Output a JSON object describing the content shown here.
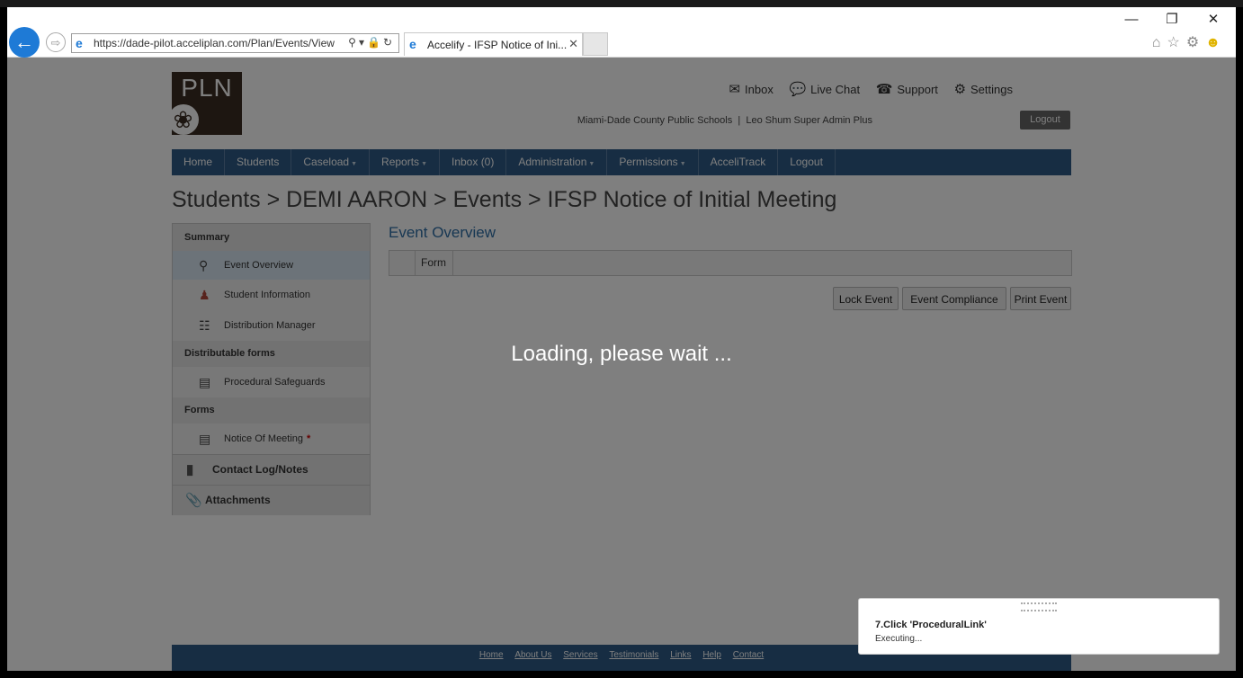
{
  "browser": {
    "url": "https://dade-pilot.acceliplan.com/Plan/Events/View",
    "tab_title": "Accelify - IFSP Notice of Ini...",
    "window_controls": {
      "minimize": "—",
      "restore": "❐",
      "close": "✕"
    }
  },
  "header": {
    "logo_text": "PLN",
    "links": [
      {
        "icon": "mail-icon",
        "label": "Inbox"
      },
      {
        "icon": "chat-icon",
        "label": "Live Chat"
      },
      {
        "icon": "phone-icon",
        "label": "Support"
      },
      {
        "icon": "gear-icon",
        "label": "Settings"
      }
    ],
    "organization": "Miami-Dade County Public Schools",
    "separator": "|",
    "user": "Leo Shum Super Admin Plus",
    "logout_label": "Logout"
  },
  "nav": {
    "items": [
      {
        "label": "Home",
        "dropdown": false
      },
      {
        "label": "Students",
        "dropdown": false
      },
      {
        "label": "Caseload",
        "dropdown": true
      },
      {
        "label": "Reports",
        "dropdown": true
      },
      {
        "label": "Inbox (0)",
        "dropdown": false
      },
      {
        "label": "Administration",
        "dropdown": true
      },
      {
        "label": "Permissions",
        "dropdown": true
      },
      {
        "label": "AcceliTrack",
        "dropdown": false
      },
      {
        "label": "Logout",
        "dropdown": false
      }
    ]
  },
  "breadcrumb": "Students > DEMI AARON > Events > IFSP Notice of Initial Meeting",
  "sidebar": {
    "summary_label": "Summary",
    "summary_items": [
      "Event Overview",
      "Student Information",
      "Distribution Manager"
    ],
    "distributable_label": "Distributable forms",
    "distributable_items": [
      "Procedural Safeguards"
    ],
    "forms_label": "Forms",
    "forms_items": [
      "Notice Of Meeting"
    ],
    "required_mark": "*",
    "contact_log_label": "Contact Log/Notes",
    "attachments_label": "Attachments"
  },
  "main": {
    "title": "Event Overview",
    "column_header": "Form",
    "buttons": [
      "Lock Event",
      "Event Compliance",
      "Print Event"
    ]
  },
  "loading_text": "Loading, please wait ...",
  "footer": {
    "links": [
      "Home",
      "About Us",
      "Services",
      "Testimonials",
      "Links",
      "Help",
      "Contact"
    ]
  },
  "toast": {
    "step": "7.Click 'ProceduralLink'",
    "status": "Executing..."
  },
  "colors": {
    "nav_bg": "#2e5b86",
    "title_blue": "#2e6ea6",
    "required_red": "#cc0000"
  }
}
